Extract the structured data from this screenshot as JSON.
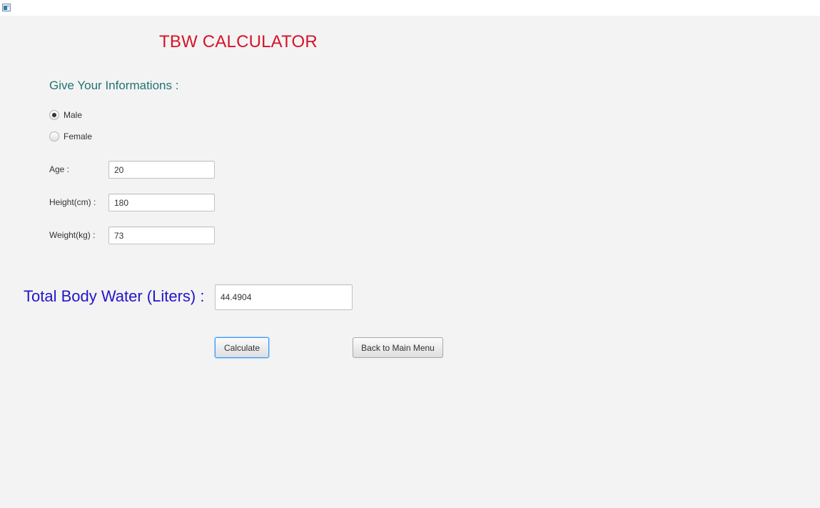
{
  "window": {
    "icon": "java-app-icon"
  },
  "header": {
    "title": "TBW CALCULATOR"
  },
  "form": {
    "heading": "Give Your Informations :",
    "gender": {
      "options": [
        {
          "label": "Male",
          "checked": true
        },
        {
          "label": "Female",
          "checked": false
        }
      ]
    },
    "fields": {
      "age": {
        "label": "Age :",
        "value": "20"
      },
      "height": {
        "label": "Height(cm) :",
        "value": "180"
      },
      "weight": {
        "label": "Weight(kg) :",
        "value": "73"
      }
    }
  },
  "result": {
    "label": "Total Body Water (Liters) :",
    "value": "44.4904"
  },
  "buttons": {
    "calculate": "Calculate",
    "back": "Back to Main Menu"
  },
  "colors": {
    "title": "#d6132a",
    "heading": "#237373",
    "result_label": "#2315c8",
    "background": "#f3f3f3",
    "focus_ring": "#3b99fc"
  }
}
